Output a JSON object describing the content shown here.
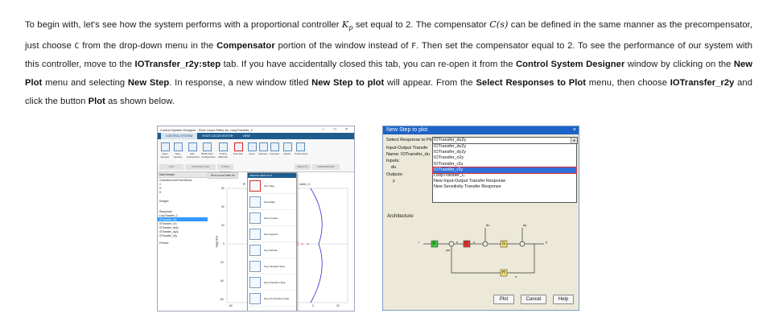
{
  "paragraph": {
    "s1": "To begin with, let's see how the system performs with a proportional controller ",
    "kp": "K",
    "kp_sub": "p",
    "s2": " set equal to 2. The compensator ",
    "cs": "C(s)",
    "s3": " can be defined in the same manner as the precompensator, just choose ",
    "c_code": "C",
    "s4": " from the drop-down menu in the ",
    "b_compensator": "Compensator",
    "s5": " portion of the window instead of ",
    "f_code": "F",
    "s6": ". Then set the compensator equal to 2. To see the performance of our system with this controller, move to the ",
    "b_tab": "IOTransfer_r2y:step",
    "s7": " tab. If you have accidentally closed this tab, you can re-open it from the ",
    "b_csd": "Control System Designer",
    "s8": " window by clicking on the ",
    "b_newplot": "New Plot",
    "s9": " menu and selecting ",
    "b_newstep": "New Step",
    "s10": ". In response, a new window titled ",
    "b_newsteptoplot": "New Step to plot",
    "s11": " will appear. From the ",
    "b_select": "Select Responses to Plot",
    "s12": " menu, then choose ",
    "b_r2y": "IOTransfer_r2y",
    "s13": " and click the button ",
    "b_plot": "Plot",
    "s14": " as shown below."
  },
  "csd": {
    "title": "Control System Designer - Root Locus Editor for LoopTransfer_C",
    "tabs": [
      "CONTROL SYSTEM",
      "ROOT LOCUS EDITOR",
      "VIEW"
    ],
    "ribbon_labels": [
      "Open Session",
      "Save Session",
      "Edit Architecture",
      "Multimodel Configuration",
      "Tuning Methods",
      "New Plot",
      "Store",
      "Retrieve",
      "Compare",
      "Export",
      "Preferences"
    ],
    "sections": [
      "FILE",
      "ARCHITECTURE",
      "TUNING METHODS",
      "RESULTS",
      "PREFERENCES"
    ],
    "browser_title": "Data Browser",
    "browser_items": [
      "Controllers and Fixed Blocks",
      "C",
      "G",
      "H",
      "Designs",
      "Responses",
      "LoopTransfer_C",
      "IOTransfer_r2y",
      "IOTransfer_r2u",
      "IOTransfer_du2y",
      "IOTransfer_dy2y",
      "IOTransfer_n2y",
      "Preview"
    ],
    "plot_tab": "Root Locus Editor for",
    "plot_label": "R",
    "plot_label2": "nsfer_C",
    "ylabel": "Imag Axis",
    "yticks": [
      "60",
      "40",
      "20",
      "0",
      "-20",
      "-40",
      "-60"
    ],
    "xticks": [
      "-60",
      "0",
      "20"
    ],
    "menu_title": "CREATE NEW PLOT",
    "menu_items": [
      "New Step",
      "New Bode",
      "New Impulse",
      "New Nyquist",
      "New Nichols",
      "New Singular Value",
      "New Pole/Zero Map",
      "New I/O Pole/Zero Map"
    ],
    "window_controls": "– □ ×"
  },
  "dialog": {
    "title": "New Step to plot",
    "close": "×",
    "select_label": "Select Response to Plot:",
    "combo_value": "IOTransfer_du2y",
    "io_label": "Input-Output Transfe",
    "name_label": "Name: IOTransfer_du",
    "inputs_label": "Inputs:",
    "inputs_value": "du",
    "outputs_label": "Outputs:",
    "outputs_value": "y",
    "options": [
      "IOTransfer_du2y",
      "IOTransfer_dy2y",
      "IOTransfer_n2y",
      "IOTransfer_r2u",
      "IOTransfer_r2y",
      "LoopTransfer_C",
      "New Input-Output Transfer Response",
      "New Sensitivity Transfer Response"
    ],
    "selected_index": 4,
    "architecture_label": "Architecture:",
    "blocks": {
      "F": "F",
      "C": "C",
      "G": "G",
      "H": "H"
    },
    "signals": {
      "r": "r",
      "ym": "ym",
      "e": "e",
      "u": "u",
      "du": "du",
      "dy": "dy",
      "y": "y",
      "n": "n"
    },
    "buttons": [
      "Plot",
      "Cancel",
      "Help"
    ]
  }
}
